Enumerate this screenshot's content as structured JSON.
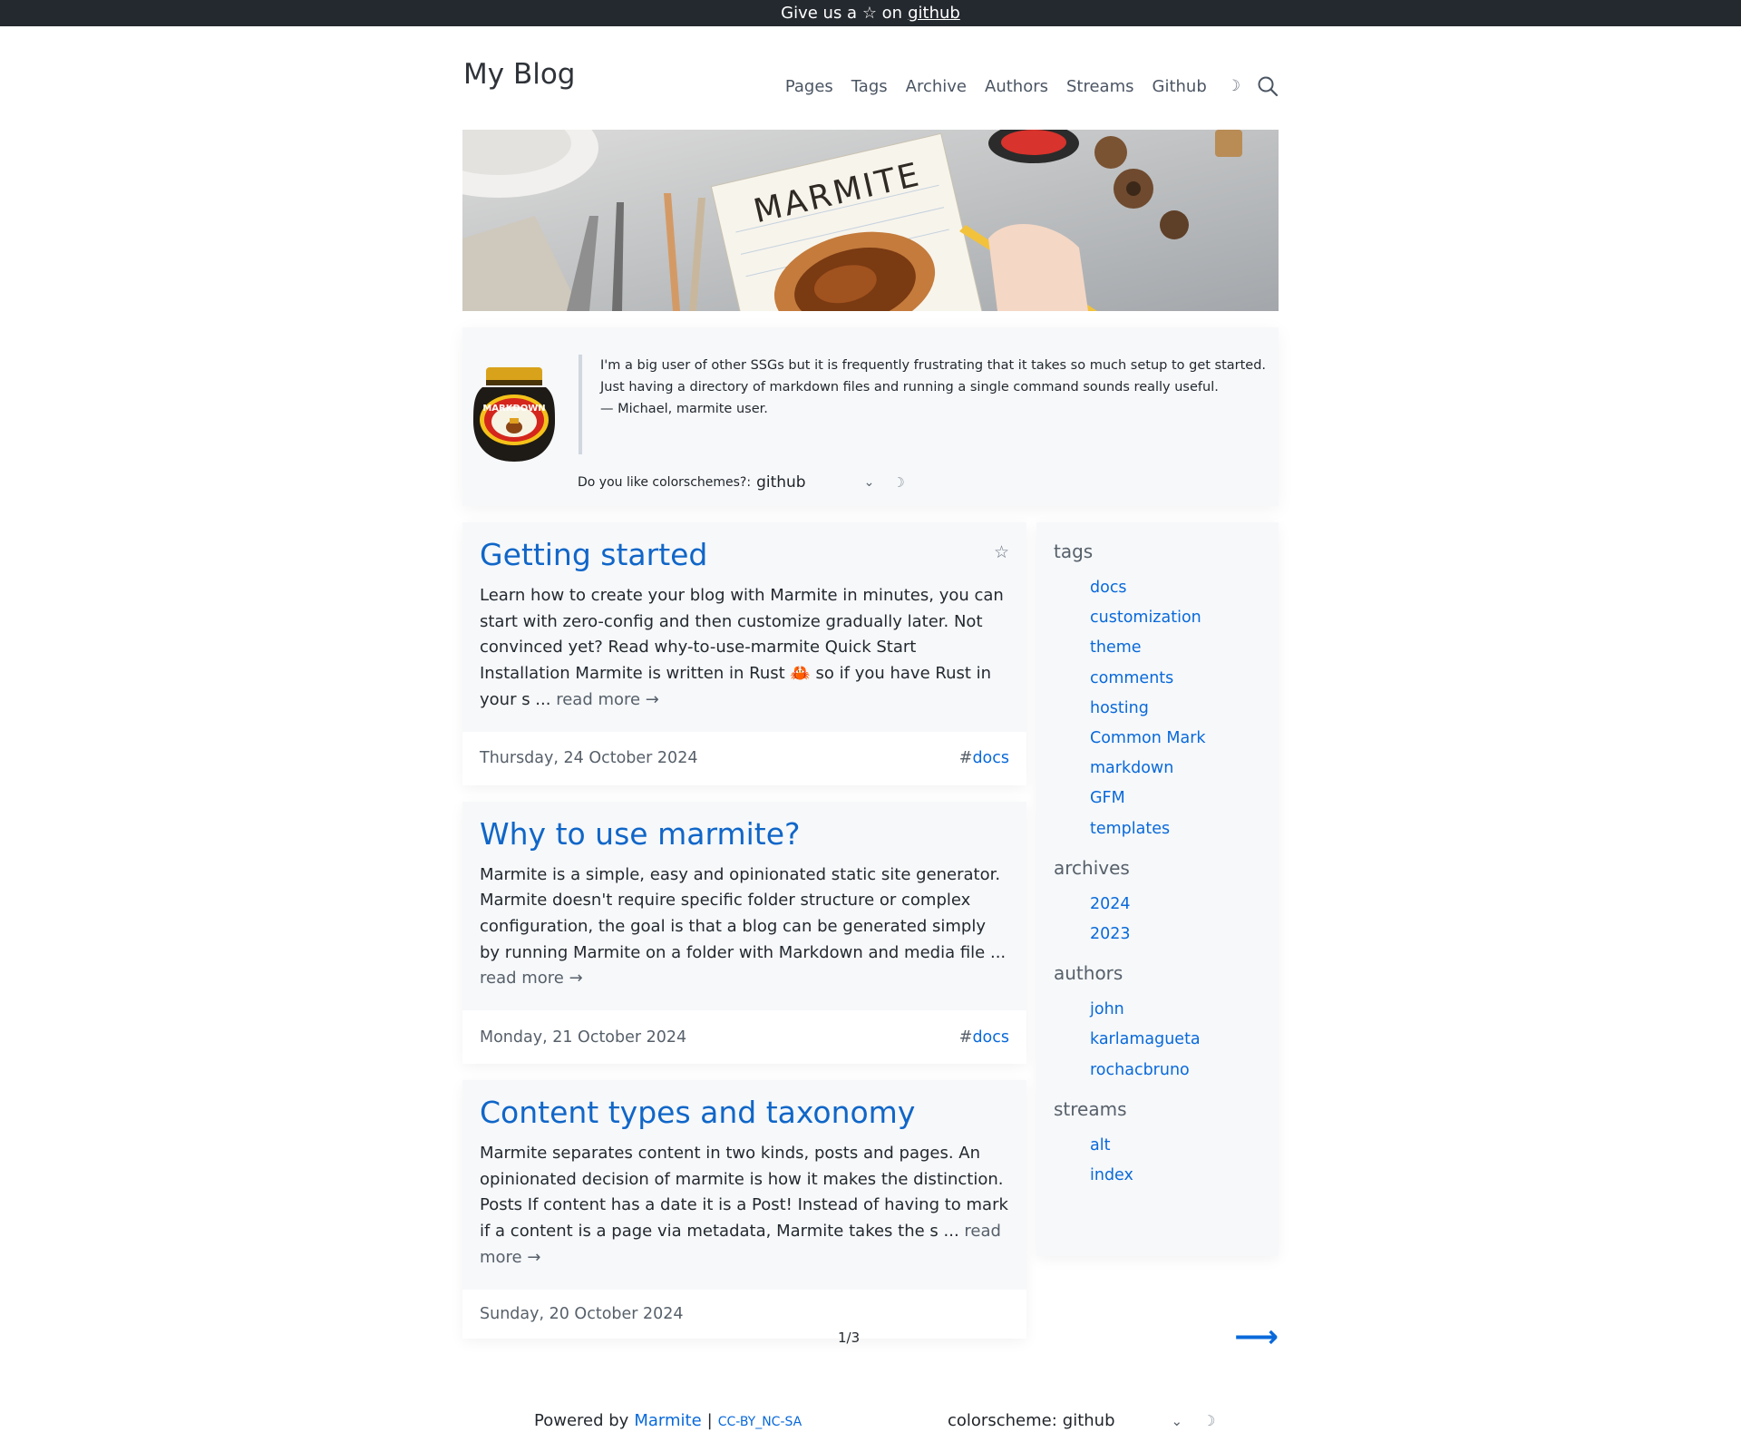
{
  "announce": {
    "prefix": "Give us a ☆ on",
    "link": "github"
  },
  "header": {
    "brand": "My Blog",
    "nav": [
      "Pages",
      "Tags",
      "Archive",
      "Authors",
      "Streams",
      "Github"
    ],
    "theme_icon": "moon-icon",
    "search_icon": "search-icon"
  },
  "banner": {
    "text": "MARMITE"
  },
  "hero": {
    "quote_lines": [
      "I'm a big user of other SSGs but it is frequently frustrating that it takes so much setup to get started.",
      "Just having a directory of markdown files and running a single command sounds really useful.",
      "— Michael, marmite user."
    ],
    "jar_label": "MARKDOWN",
    "colorscheme_label": "Do you like colorschemes?:",
    "colorscheme_value": "github",
    "chevron": "⌄",
    "moon": "☽"
  },
  "posts": [
    {
      "title": "Getting started",
      "excerpt": "Learn how to create your blog with Marmite in minutes, you can start with zero-config and then customize gradually later. Not convinced yet? Read why-to-use-marmite Quick Start Installation Marmite is written in Rust 🦀 so if you have Rust in your s ...",
      "read_more": "read more →",
      "date": "Thursday, 24 October 2024",
      "tag_hash": "#",
      "tag": "docs",
      "star": "☆"
    },
    {
      "title": "Why to use marmite?",
      "excerpt": "Marmite is a simple, easy and opinionated static site generator. Marmite doesn't require specific folder structure or complex configuration, the goal is that a blog can be generated simply by running Marmite on a folder with Markdown and media file ...",
      "read_more": "read more →",
      "date": "Monday, 21 October 2024",
      "tag_hash": "#",
      "tag": "docs"
    },
    {
      "title": "Content types and taxonomy",
      "excerpt": "Marmite separates content in two kinds, posts and pages. An opinionated decision of marmite is how it makes the distinction. Posts If content has a date it is a Post! Instead of having to mark if a content is a page via metadata, Marmite takes the s ...",
      "read_more": "read more →",
      "date": "Sunday, 20 October 2024"
    }
  ],
  "sidebar": {
    "tags_heading": "tags",
    "tags": [
      "docs",
      "customization",
      "theme",
      "comments",
      "hosting",
      "Common Mark",
      "markdown",
      "GFM",
      "templates"
    ],
    "archives_heading": "archives",
    "archives": [
      "2024",
      "2023"
    ],
    "authors_heading": "authors",
    "authors": [
      "john",
      "karlamagueta",
      "rochacbruno"
    ],
    "streams_heading": "streams",
    "streams": [
      "alt",
      "index"
    ]
  },
  "pager": {
    "page": "1/3",
    "next": "⟶"
  },
  "footer": {
    "powered": "Powered by",
    "marmite": "Marmite",
    "sep": "|",
    "license": "CC-BY_NC-SA",
    "colorscheme_label": "colorscheme:",
    "colorscheme_value": "github",
    "chevron": "⌄",
    "moon": "☽"
  },
  "colors": {
    "accent": "#0969da",
    "title": "#1066c8",
    "topbar": "#24292f",
    "card": "#f6f8fa"
  }
}
